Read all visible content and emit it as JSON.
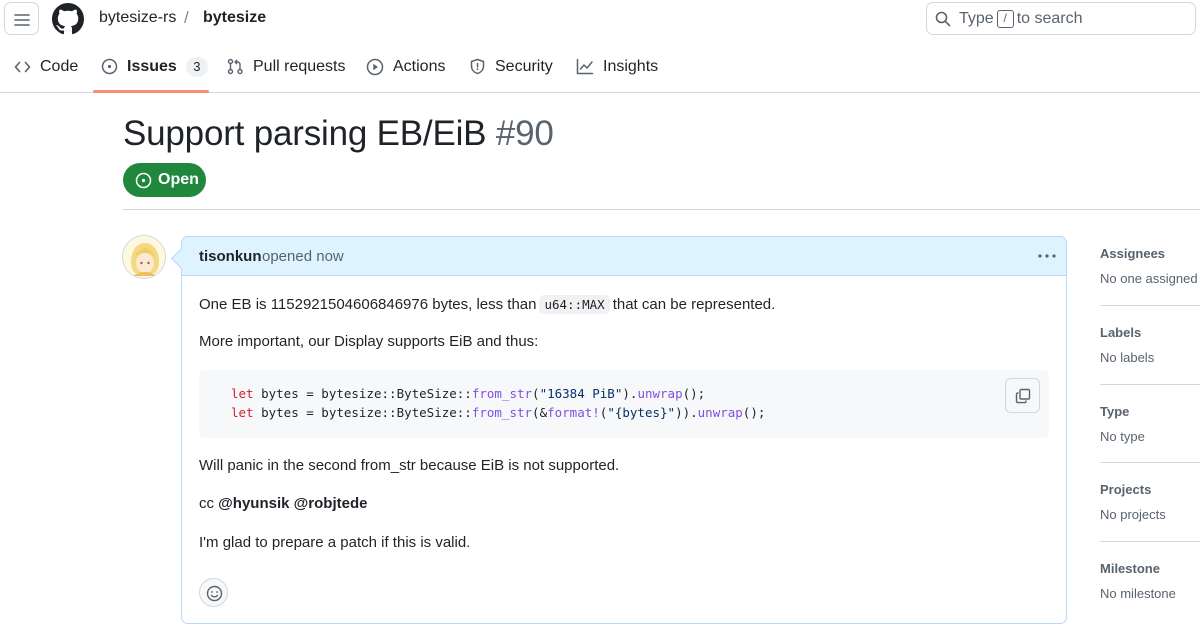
{
  "header": {
    "owner": "bytesize-rs",
    "separator": "/",
    "repo": "bytesize",
    "search_prefix": "Type",
    "search_key": "/",
    "search_suffix": "to search"
  },
  "nav": {
    "tabs": [
      {
        "label": "Code",
        "icon": "code-icon"
      },
      {
        "label": "Issues",
        "icon": "issue-opened-icon",
        "count": "3",
        "selected": true
      },
      {
        "label": "Pull requests",
        "icon": "git-pull-request-icon"
      },
      {
        "label": "Actions",
        "icon": "play-icon"
      },
      {
        "label": "Security",
        "icon": "shield-icon"
      },
      {
        "label": "Insights",
        "icon": "graph-icon"
      }
    ]
  },
  "issue": {
    "title": "Support parsing EB/EiB",
    "number": "#90",
    "state": "Open",
    "state_color": "#1f883d"
  },
  "comment": {
    "author": "tisonkun",
    "meta": "opened now",
    "p1_before": "One EB is 1152921504606846976 bytes, less than",
    "p1_code": "u64::MAX",
    "p1_after": "that can be represented.",
    "p2": "More important, our Display supports EiB and thus:",
    "code_lines": [
      "let bytes = bytesize::ByteSize::from_str(\"16384 PiB\").unwrap();",
      "let bytes = bytesize::ByteSize::from_str(&format!(\"{bytes}\")).unwrap();"
    ],
    "code_parts": {
      "kw": "let",
      "l1_a": " bytes = bytesize::ByteSize::",
      "l1_fn": "from_str",
      "l1_b": "(",
      "l1_str": "\"16384 PiB\"",
      "l1_c": ").",
      "l1_fn2": "unwrap",
      "l1_d": "();",
      "l2_a": " bytes = bytesize::ByteSize::",
      "l2_fn": "from_str",
      "l2_b": "(&",
      "l2_fn_fmt": "format!",
      "l2_c": "(",
      "l2_str": "\"{bytes}\"",
      "l2_d": ")).",
      "l2_fn2": "unwrap",
      "l2_e": "();"
    },
    "p3": "Will panic in the second from_str because EiB is not supported.",
    "p4_prefix": "cc",
    "mentions": [
      "@hyunsik",
      "@robjtede"
    ],
    "p5": "I'm glad to prepare a patch if this is valid."
  },
  "sidebar": [
    {
      "heading": "Assignees",
      "value": "No one assigned"
    },
    {
      "heading": "Labels",
      "value": "No labels"
    },
    {
      "heading": "Type",
      "value": "No type"
    },
    {
      "heading": "Projects",
      "value": "No projects"
    },
    {
      "heading": "Milestone",
      "value": "No milestone"
    }
  ]
}
